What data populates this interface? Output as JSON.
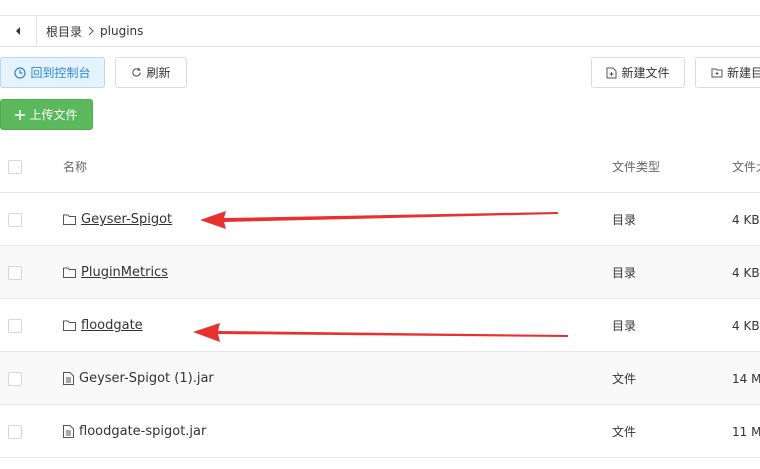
{
  "breadcrumb": {
    "root": "根目录",
    "current": "plugins"
  },
  "toolbar": {
    "dashboard": "回到控制台",
    "refresh": "刷新",
    "new_file": "新建文件",
    "new_dir": "新建目",
    "upload": "上传文件"
  },
  "table": {
    "headers": {
      "name": "名称",
      "type": "文件类型",
      "size": "文件大"
    },
    "rows": [
      {
        "name": "Geyser-Spigot",
        "type": "目录",
        "size": "4 KB",
        "kind": "folder"
      },
      {
        "name": "PluginMetrics",
        "type": "目录",
        "size": "4 KB",
        "kind": "folder"
      },
      {
        "name": "floodgate",
        "type": "目录",
        "size": "4 KB",
        "kind": "folder"
      },
      {
        "name": "Geyser-Spigot (1).jar",
        "type": "文件",
        "size": "14 MB",
        "kind": "file"
      },
      {
        "name": "floodgate-spigot.jar",
        "type": "文件",
        "size": "11 MB",
        "kind": "file"
      }
    ]
  },
  "colors": {
    "accent_blue": "#2a8bd6",
    "upload_green": "#5cb85c",
    "annotation_red": "#e8312f"
  }
}
